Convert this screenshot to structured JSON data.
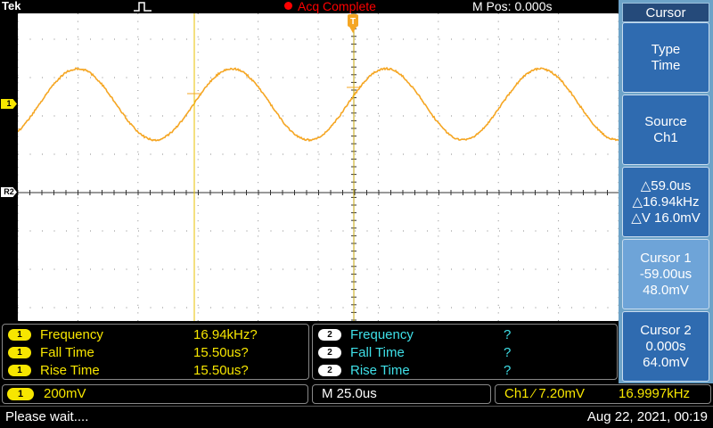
{
  "topbar": {
    "brand": "Tek",
    "acq_status": "Acq Complete",
    "mpos": "M Pos: 0.000s"
  },
  "markers": {
    "ch1": "1",
    "ref2": "R2",
    "trigger_pos": "T"
  },
  "menu": {
    "title": "Cursor",
    "buttons": [
      {
        "lines": [
          "Type",
          "Time"
        ]
      },
      {
        "lines": [
          "Source",
          "Ch1"
        ]
      },
      {
        "lines": [
          "△59.0us",
          "△16.94kHz",
          "△V 16.0mV"
        ]
      },
      {
        "lines": [
          "Cursor 1",
          "-59.00us",
          "48.0mV"
        ]
      },
      {
        "lines": [
          "Cursor 2",
          "0.000s",
          "64.0mV"
        ]
      }
    ]
  },
  "measurements": {
    "left": [
      {
        "badge": "1",
        "label": "Frequency",
        "value": "16.94kHz?"
      },
      {
        "badge": "1",
        "label": "Fall Time",
        "value": "15.50us?"
      },
      {
        "badge": "1",
        "label": "Rise Time",
        "value": "15.50us?"
      }
    ],
    "right": [
      {
        "badge": "2",
        "label": "Frequency",
        "value": "?"
      },
      {
        "badge": "2",
        "label": "Fall Time",
        "value": "?"
      },
      {
        "badge": "2",
        "label": "Rise Time",
        "value": "?"
      }
    ]
  },
  "infobar": {
    "ch1_badge": "1",
    "ch1_scale": "200mV",
    "time_scale": "M 25.0us",
    "trigger_source": "Ch1 ⁄ 7.20mV",
    "trigger_freq": "16.9997kHz"
  },
  "statusbar": {
    "message": "Please wait....",
    "datetime": "Aug 22, 2021, 00:19"
  },
  "colors": {
    "trace": "#f5a623",
    "cursor_line": "#e8c200",
    "ch1": "#f7e600",
    "ch2": "#3fe0e8",
    "menu_bg": "#6da3c8",
    "menu_btn": "#2f6bb0",
    "acq_status": "#ff0000"
  }
}
